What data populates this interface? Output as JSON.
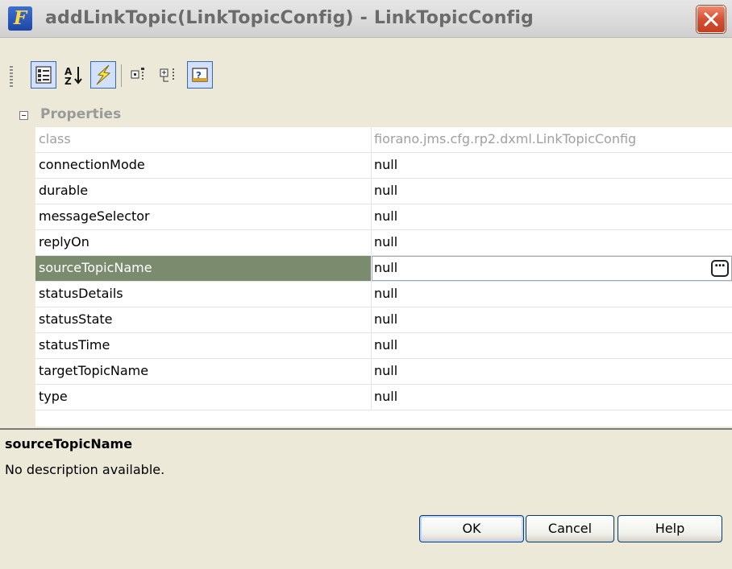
{
  "window": {
    "title": "addLinkTopic(LinkTopicConfig) - LinkTopicConfig",
    "icon_letter": "F"
  },
  "toolbar": {
    "buttons": [
      {
        "name": "categorized-view",
        "active": true
      },
      {
        "name": "alphabetical-sort",
        "active": false
      },
      {
        "name": "events",
        "active": true
      },
      {
        "name": "show-editable",
        "active": false
      },
      {
        "name": "show-all",
        "active": false
      },
      {
        "name": "show-help",
        "active": true
      }
    ]
  },
  "grid": {
    "category": "Properties",
    "rows": [
      {
        "name": "class",
        "value": "fiorano.jms.cfg.rp2.dxml.LinkTopicConfig",
        "readonly": true
      },
      {
        "name": "connectionMode",
        "value": "null"
      },
      {
        "name": "durable",
        "value": "null"
      },
      {
        "name": "messageSelector",
        "value": "null"
      },
      {
        "name": "replyOn",
        "value": "null"
      },
      {
        "name": "sourceTopicName",
        "value": "null",
        "selected": true
      },
      {
        "name": "statusDetails",
        "value": "null"
      },
      {
        "name": "statusState",
        "value": "null"
      },
      {
        "name": "statusTime",
        "value": "null"
      },
      {
        "name": "targetTopicName",
        "value": "null"
      },
      {
        "name": "type",
        "value": "null"
      }
    ],
    "ellipsis_label": "..."
  },
  "description": {
    "title": "sourceTopicName",
    "text": "No description available."
  },
  "buttons": {
    "ok": "OK",
    "cancel": "Cancel",
    "help": "Help"
  }
}
